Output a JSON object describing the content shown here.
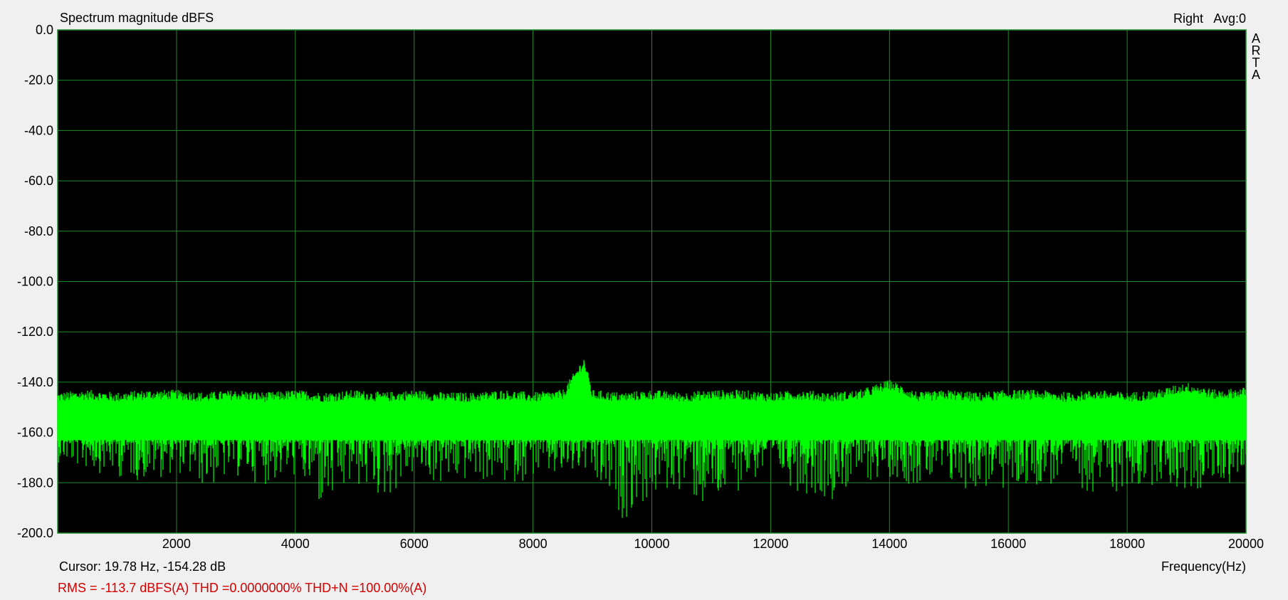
{
  "window": {
    "title": "Spectrum magnitude dBFS",
    "channel": "Right",
    "avg": "Avg:0",
    "brand_vertical": [
      "A",
      "R",
      "T",
      "A"
    ],
    "cursor_readout": "Cursor: 19.78 Hz, -154.28 dB",
    "measurement": "RMS = -113.7 dBFS(A)   THD =0.0000000%   THD+N =100.00%(A)"
  },
  "colors": {
    "plot_background": "#000000",
    "grid": "#1f8a2a",
    "trace": "#00ff00",
    "measurement_text": "#d40000"
  },
  "chart_data": {
    "type": "line",
    "title": "Spectrum magnitude dBFS",
    "xlabel": "Frequency(Hz)",
    "ylabel": "",
    "xlim": [
      0,
      20000
    ],
    "ylim": [
      -200,
      0
    ],
    "x_ticks": [
      2000,
      4000,
      6000,
      8000,
      10000,
      12000,
      14000,
      16000,
      18000,
      20000
    ],
    "y_ticks": [
      0,
      -20,
      -40,
      -60,
      -80,
      -100,
      -120,
      -140,
      -160,
      -180,
      -200
    ],
    "y_tick_labels": [
      "0.0",
      "-20.0",
      "-40.0",
      "-60.0",
      "-80.0",
      "-100.0",
      "-120.0",
      "-140.0",
      "-160.0",
      "-180.0",
      "-200.0"
    ],
    "grid": true,
    "series": [
      {
        "style": "noise floor (spectrum)",
        "x": [
          0,
          500,
          1000,
          1500,
          2000,
          2500,
          3000,
          3500,
          4000,
          4500,
          5000,
          5500,
          6000,
          6500,
          7000,
          7500,
          8000,
          8500,
          8860,
          9000,
          9500,
          10000,
          10500,
          11000,
          11500,
          12000,
          12500,
          13000,
          13500,
          14000,
          14500,
          15000,
          15500,
          16000,
          16500,
          17000,
          17500,
          18000,
          18500,
          19000,
          19500,
          20000
        ],
        "y_max": [
          -146,
          -145,
          -146,
          -145,
          -145,
          -146,
          -145,
          -146,
          -145,
          -146,
          -145,
          -146,
          -145,
          -146,
          -146,
          -145,
          -146,
          -145,
          -132,
          -145,
          -146,
          -145,
          -146,
          -145,
          -145,
          -146,
          -145,
          -146,
          -145,
          -141,
          -146,
          -145,
          -146,
          -145,
          -145,
          -146,
          -145,
          -146,
          -145,
          -142,
          -145,
          -144
        ],
        "y_min": [
          -172,
          -175,
          -178,
          -180,
          -176,
          -183,
          -178,
          -181,
          -178,
          -195,
          -182,
          -188,
          -177,
          -183,
          -179,
          -182,
          -178,
          -180,
          -176,
          -184,
          -195,
          -188,
          -183,
          -196,
          -182,
          -177,
          -184,
          -187,
          -181,
          -178,
          -182,
          -184,
          -183,
          -185,
          -181,
          -183,
          -184,
          -186,
          -180,
          -186,
          -182,
          -178
        ]
      }
    ],
    "cursor": {
      "x": 19.78,
      "y": -154.28
    }
  }
}
